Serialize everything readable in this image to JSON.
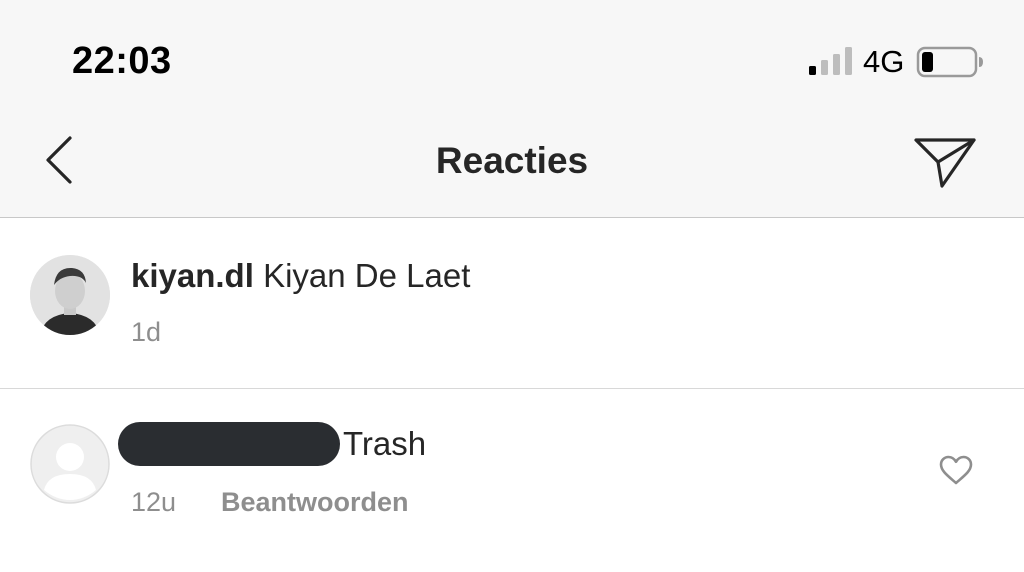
{
  "status_bar": {
    "time": "22:03",
    "network": "4G",
    "signal_icon": "signal-bars-icon",
    "battery_icon": "battery-icon"
  },
  "nav": {
    "title": "Reacties",
    "back_icon": "chevron-left-icon",
    "send_icon": "paper-plane-icon"
  },
  "post": {
    "username": "kiyan.dl",
    "text": "Kiyan De Laet",
    "time": "1d"
  },
  "comment": {
    "text": "Trash",
    "time": "12u",
    "reply_label": "Beantwoorden",
    "like_icon": "heart-outline-icon"
  },
  "colors": {
    "header_bg": "#f7f7f7",
    "text_primary": "#262626",
    "text_secondary": "#8e8e8e",
    "redaction": "#2a2d31"
  }
}
